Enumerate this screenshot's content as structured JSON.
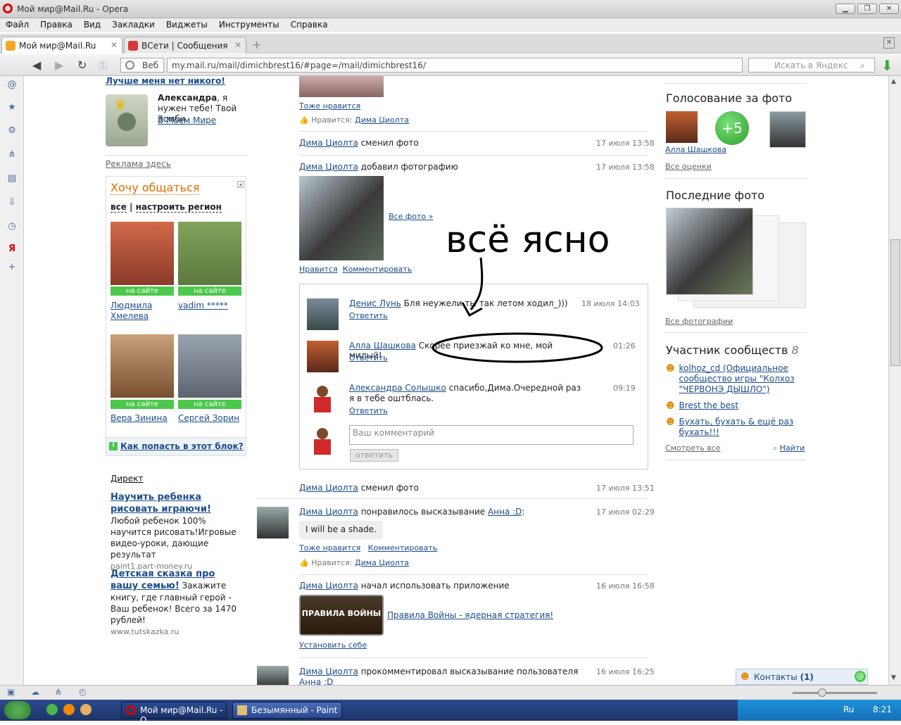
{
  "window": {
    "title": "Мой мир@Mail.Ru - Opera"
  },
  "menu": [
    "Файл",
    "Правка",
    "Вид",
    "Закладки",
    "Виджеты",
    "Инструменты",
    "Справка"
  ],
  "tabs": [
    {
      "label": "Мой мир@Mail.Ru"
    },
    {
      "label": "ВСети | Сообщения"
    }
  ],
  "address": {
    "web_label": "Веб",
    "url": "my.mail.ru/mail/dimichbrest16/#page=/mail/dimichbrest16/",
    "search_placeholder": "Искать в Яндекс"
  },
  "left": {
    "top_link": "Лучше меня нет никого!",
    "zombie": {
      "name": "Александра",
      "text": ", я нужен тебе! Твой Зомби.",
      "link": "В Моем Мире"
    },
    "ad_link": "Реклама здесь",
    "want": {
      "title": "Хочу общаться",
      "all": "все",
      "region": "настроить регион",
      "people": [
        {
          "name": "Людмила Хмелева",
          "status": "на сайте"
        },
        {
          "name": "vadim *****",
          "status": "на сайте"
        },
        {
          "name": "Вера Зинина",
          "status": "на сайте"
        },
        {
          "name": "Сергей Зорин",
          "status": "на сайте"
        }
      ],
      "howto": "Как попасть в этот блок?"
    },
    "direct": {
      "title": "Директ",
      "ads": [
        {
          "title": "Научить ребенка рисовать играючи!",
          "text": " Любой ребенок 100% научится рисовать!Игровые видео-уроки, дающие результат",
          "site": "paint1.part-money.ru"
        },
        {
          "title": "Детская сказка про вашу семью!",
          "text": " Закажите книгу, где главный герой - Ваш ребенок! Всего за 1470 рублей!",
          "site": "www.tutskazka.ru"
        }
      ]
    }
  },
  "feed": {
    "also_like": "Тоже нравится",
    "likes_label": "Нравится:",
    "liker": "Дима Циолта",
    "item1": {
      "user": "Дима Циолта",
      "action": "сменил фото",
      "time": "17 июля 13:58"
    },
    "item2": {
      "user": "Дима Циолта",
      "action": "добавил фотографию",
      "time": "17 июля 13:58",
      "all_photos": "Все фото »",
      "like": "Нравится",
      "comment": "Комментировать"
    },
    "comments": [
      {
        "user": "Денис Лунь",
        "text": " Бля неужели ты так летом ходил_)))",
        "time": "18 июля 14:03",
        "reply": "Ответить"
      },
      {
        "user": "Алла Шашкова",
        "text": " Скорее приезжай ко мне, мой милый!",
        "time": "01:26",
        "reply": "Ответить"
      },
      {
        "user": "Александра Солышко",
        "text": " спасибо,Дима.Очередной раз я в тебе оштблась.",
        "time": "09:19",
        "reply": "Ответить"
      }
    ],
    "comment_placeholder": "Ваш комментарий",
    "comment_button": "ответить",
    "item3": {
      "user": "Дима Циолта",
      "action": "сменил фото",
      "time": "17 июля 13:51"
    },
    "item4": {
      "user": "Дима Циолта",
      "action": "понравилось высказывание",
      "target": "Анна :D",
      "colon": ":",
      "time": "17 июля 02:29",
      "quote": "I will be a shade.",
      "also_like": "Тоже нравится",
      "comment": "Комментировать"
    },
    "item5": {
      "user": "Дима Циолта",
      "action": "начал использовать приложение",
      "time": "16 июля 16:58",
      "app": "Правила Войны - ядерная стратегия!",
      "app_logo": "ПРАВИЛА ВОЙНЫ",
      "install": "Установить себе"
    },
    "item6": {
      "user": "Дима Циолта",
      "action": "прокомментировал высказывание пользователя",
      "target": "Анна :D",
      "time": "16 июля 16:25"
    }
  },
  "handwriting": "всё ясно",
  "right": {
    "vote": {
      "title": "Голосование за фото",
      "score": "+5",
      "user": "Алла Шашкова",
      "all": "Все оценки"
    },
    "last": {
      "title": "Последние фото",
      "all": "Все фотографии"
    },
    "communities": {
      "title": "Участник сообществ",
      "count": "8",
      "items": [
        "kolhoz_cd (Официальное сообщество игры \"Колхоз \"ЧЕРВОНЭ ДЫШЛО\")",
        "Brest the best",
        "Бухать, бухать & ещё раз бухать!!!"
      ],
      "all": "Смотреть все",
      "find": "Найти"
    }
  },
  "contacts": {
    "label": "Контакты",
    "count": "(1)"
  },
  "taskbar": {
    "items": [
      "Мой мир@Mail.Ru - O...",
      "Безымянный - Paint"
    ],
    "lang": "Ru",
    "clock": "8:21"
  },
  "colors": {
    "accent": "#1a4c8c",
    "orange": "#e06c00",
    "green": "#4cc84c"
  }
}
